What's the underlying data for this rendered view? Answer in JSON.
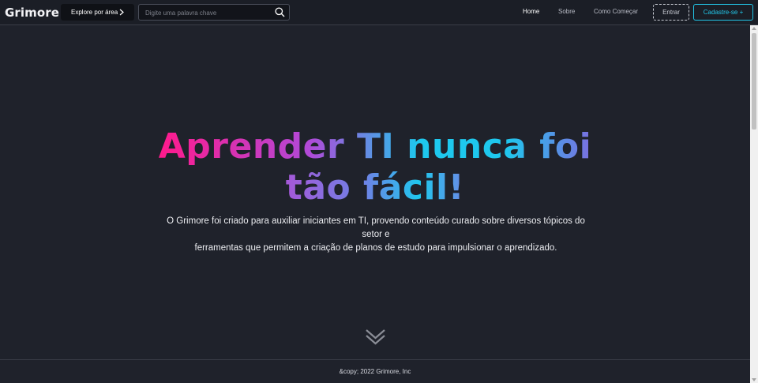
{
  "header": {
    "logo": "Grimore",
    "explore_label": "Explore por área",
    "search_placeholder": "Digite uma palavra chave",
    "nav": [
      {
        "label": "Home",
        "active": true
      },
      {
        "label": "Sobre",
        "active": false
      },
      {
        "label": "Como Começar",
        "active": false
      }
    ],
    "login_label": "Entrar",
    "signup_label": "Cadastre-se +"
  },
  "hero": {
    "title_line1": "Aprender TI nunca foi",
    "title_line2": "tão fácil!",
    "subtitle_line1": "O Grimore foi criado para auxiliar iniciantes em TI, provendo conteúdo curado sobre diversos tópicos do setor e",
    "subtitle_line2": "ferramentas que permitem a criação de planos de estudo para impulsionar o aprendizado."
  },
  "footer": {
    "copyright": "&copy; 2022 Grimore, Inc"
  },
  "colors": {
    "background": "#1f222b",
    "accent_cyan": "#22c6e8",
    "accent_pink": "#ff1a8c",
    "accent_purple": "#a558d8"
  },
  "icons": [
    "chevron-right-icon",
    "search-icon",
    "double-chevron-down-icon"
  ]
}
